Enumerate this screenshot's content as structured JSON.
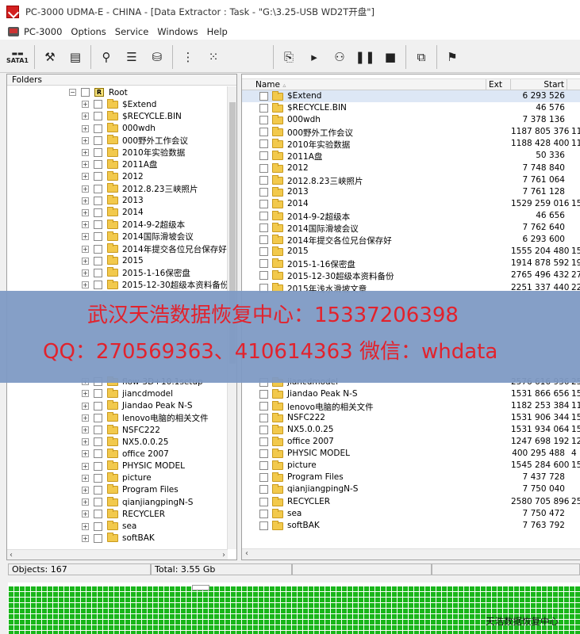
{
  "window": {
    "title": "PC-3000 UDMA-E - CHINA - [Data Extractor : Task - \"G:\\3.25-USB WD2T开盘\"]"
  },
  "menu": {
    "items": [
      "PC-3000",
      "Options",
      "Service",
      "Windows",
      "Help"
    ]
  },
  "toolbar": {
    "sata_label": "SATA1",
    "icons": [
      "sata-port",
      "tools",
      "document",
      "binoculars",
      "sort",
      "folder-open",
      "tree-view",
      "tree-view-2",
      "folder-doc",
      "play",
      "network",
      "pause",
      "stop",
      "copy",
      "exit-run"
    ]
  },
  "folders_pane": {
    "header": "Folders",
    "root_label": "Root",
    "root_badge": "R",
    "items": [
      "$Extend",
      "$RECYCLE.BIN",
      "000wdh",
      "000野外工作会议",
      "2010年实验数据",
      "2011A盘",
      "2012",
      "2012.8.23三峡照片",
      "2013",
      "2014",
      "2014-9-2超级本",
      "2014国际滑坡会议",
      "2014年提交各位兄台保存好",
      "2015",
      "2015-1-16保密盘",
      "2015-12-30超级本资料备份"
    ],
    "items_lower": [
      "flow-3D+10.1setup",
      "jiancdmodel",
      "Jiandao Peak N-S",
      "lenovo电脑的相关文件",
      "NSFC222",
      "NX5.0.0.25",
      "office 2007",
      "PHYSIC MODEL",
      "picture",
      "Program Files",
      "qianjiangpingN-S",
      "RECYCLER",
      "sea",
      "softBAK"
    ]
  },
  "list_pane": {
    "columns": {
      "name": "Name",
      "ext": "Ext",
      "start": "Start"
    },
    "rows_upper": [
      {
        "name": "$Extend",
        "start": "6 293 526",
        "extra": ""
      },
      {
        "name": "$RECYCLE.BIN",
        "start": "46 576",
        "extra": ""
      },
      {
        "name": "000wdh",
        "start": "7 378 136",
        "extra": ""
      },
      {
        "name": "000野外工作会议",
        "start": "1187 805 376",
        "extra": "11"
      },
      {
        "name": "2010年实验数据",
        "start": "1188 428 400",
        "extra": "11"
      },
      {
        "name": "2011A盘",
        "start": "50 336",
        "extra": ""
      },
      {
        "name": "2012",
        "start": "7 748 840",
        "extra": ""
      },
      {
        "name": "2012.8.23三峡照片",
        "start": "7 761 064",
        "extra": ""
      },
      {
        "name": "2013",
        "start": "7 761 128",
        "extra": ""
      },
      {
        "name": "2014",
        "start": "1529 259 016",
        "extra": "15"
      },
      {
        "name": "2014-9-2超级本",
        "start": "46 656",
        "extra": ""
      },
      {
        "name": "2014国际滑坡会议",
        "start": "7 762 640",
        "extra": ""
      },
      {
        "name": "2014年提交各位兄台保存好",
        "start": "6 293 600",
        "extra": ""
      },
      {
        "name": "2015",
        "start": "1555 204 480",
        "extra": "15"
      },
      {
        "name": "2015-1-16保密盘",
        "start": "1914 878 592",
        "extra": "19"
      },
      {
        "name": "2015-12-30超级本资料备份",
        "start": "2765 496 432",
        "extra": "27"
      },
      {
        "name": "2015年浅水滑坡文章",
        "start": "2251 337 440",
        "extra": "22"
      }
    ],
    "rows_lower": [
      {
        "name": "jiancdmodel",
        "start": "2576 616 936",
        "extra": "25"
      },
      {
        "name": "Jiandao Peak N-S",
        "start": "1531 866 656",
        "extra": "15"
      },
      {
        "name": "lenovo电脑的相关文件",
        "start": "1182 253 384",
        "extra": "11"
      },
      {
        "name": "NSFC222",
        "start": "1531 906 344",
        "extra": "15"
      },
      {
        "name": "NX5.0.0.25",
        "start": "1531 934 064",
        "extra": "15"
      },
      {
        "name": "office 2007",
        "start": "1247 698 192",
        "extra": "12"
      },
      {
        "name": "PHYSIC MODEL",
        "start": "400 295 488",
        "extra": "4"
      },
      {
        "name": "picture",
        "start": "1545 284 600",
        "extra": "15"
      },
      {
        "name": "Program Files",
        "start": "7 437 728",
        "extra": ""
      },
      {
        "name": "qianjiangpingN-S",
        "start": "7 750 040",
        "extra": ""
      },
      {
        "name": "RECYCLER",
        "start": "2580 705 896",
        "extra": "25"
      },
      {
        "name": "sea",
        "start": "7 750 472",
        "extra": ""
      },
      {
        "name": "softBAK",
        "start": "7 763 792",
        "extra": ""
      }
    ]
  },
  "status": {
    "objects": "Objects: 167",
    "total": "Total: 3.55 Gb"
  },
  "watermark": {
    "line1": "武汉天浩数据恢复中心：15337206398",
    "line2": "QQ：270569363、410614363   微信：whdata",
    "corner": "天浩数据恢复中心"
  },
  "colors": {
    "watermark_bg": "#7e9ac4",
    "watermark_text": "#e2222c",
    "sector_ok": "#19b61a"
  }
}
